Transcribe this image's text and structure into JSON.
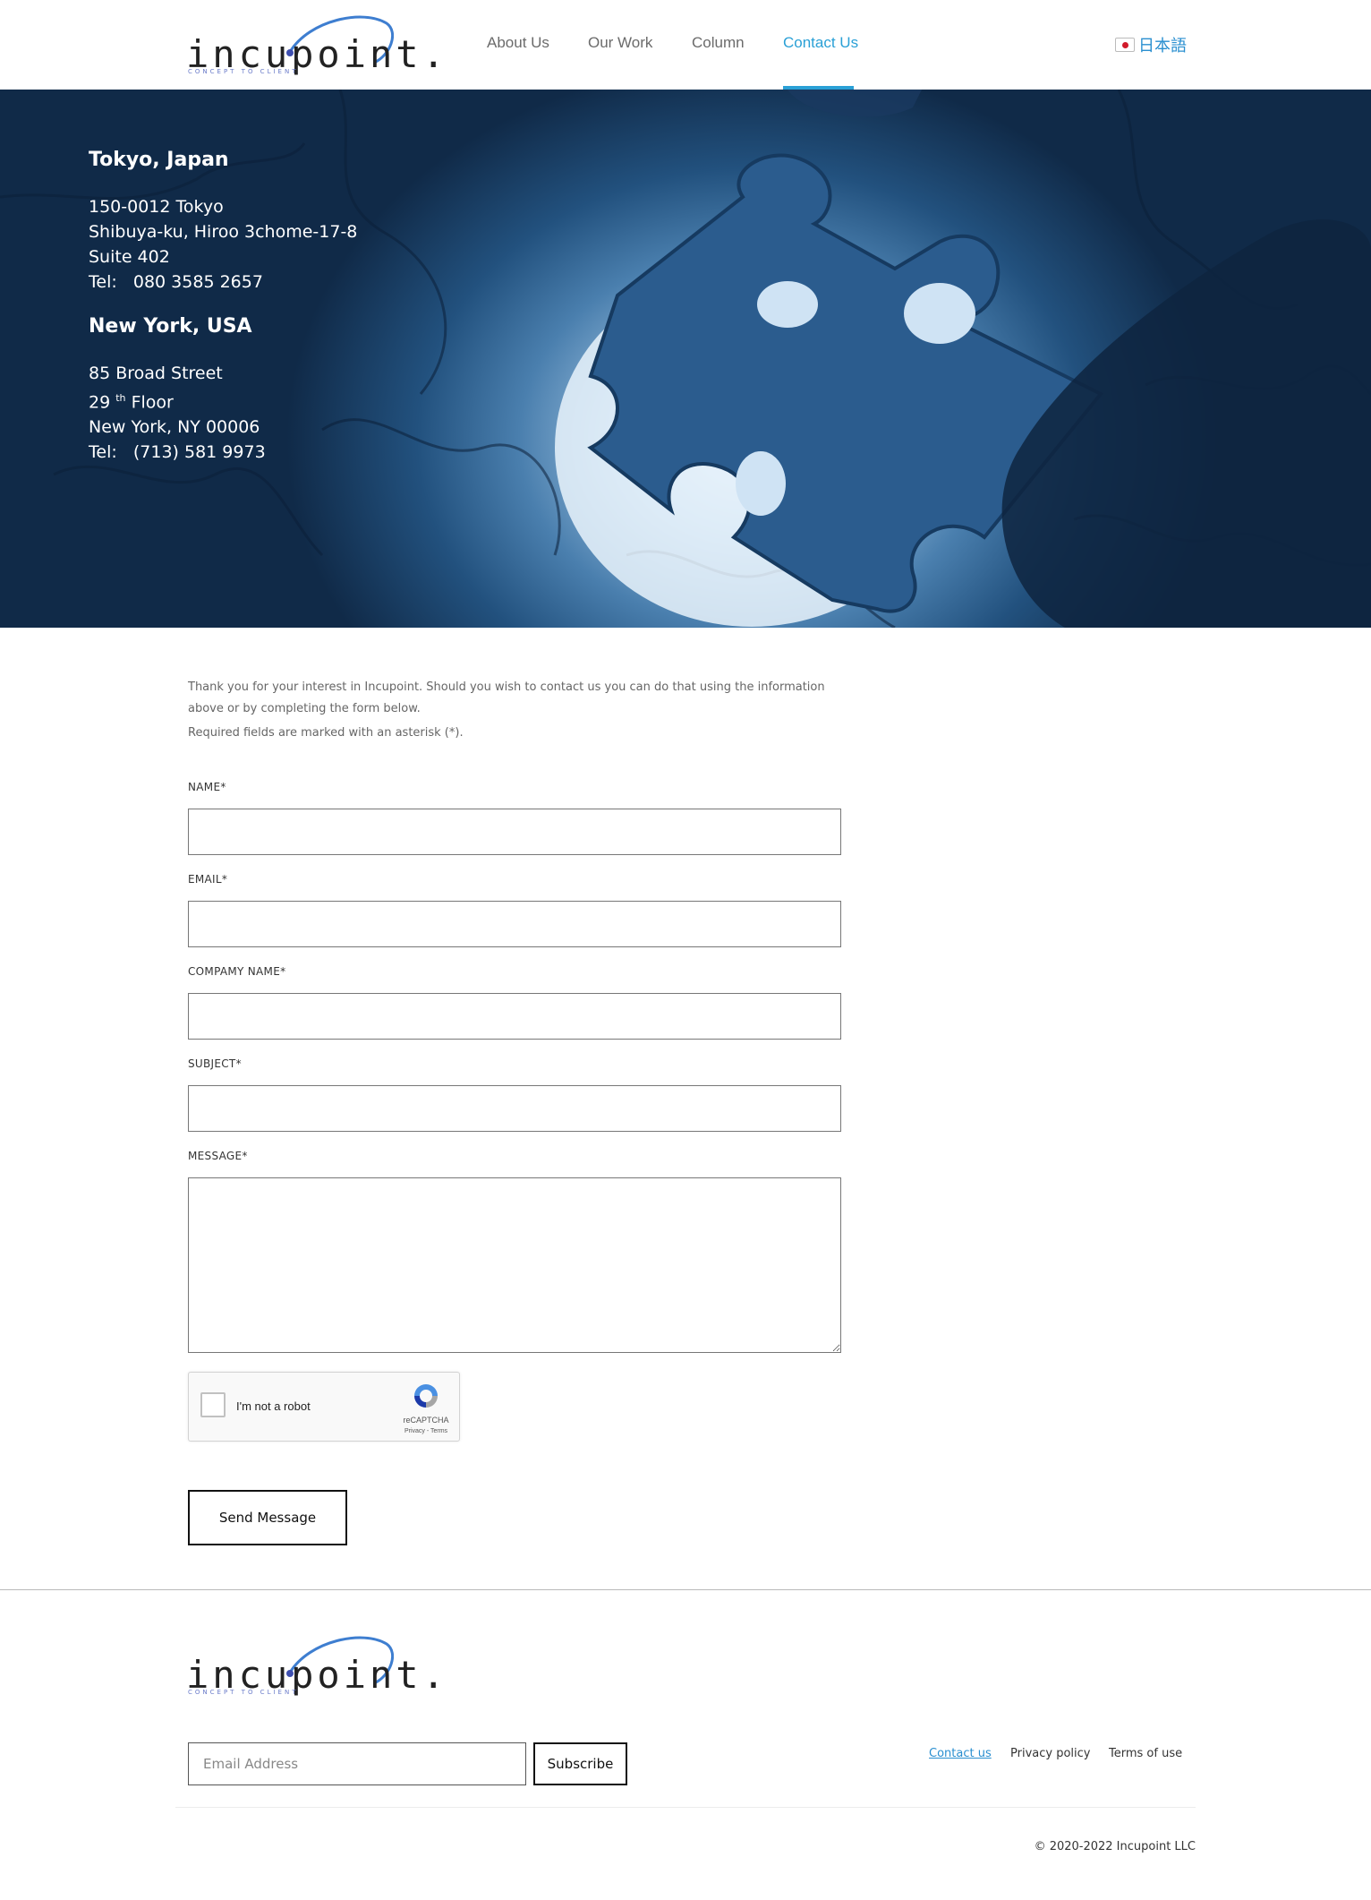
{
  "header": {
    "logo_text": "incupoint.",
    "logo_tagline": "CONCEPT TO CLIENT",
    "nav": [
      {
        "label": "About Us"
      },
      {
        "label": "Our Work"
      },
      {
        "label": "Column"
      },
      {
        "label": "Contact Us",
        "active": true
      }
    ],
    "language_label": "日本語",
    "accent_color": "#2aa0d6"
  },
  "offices": {
    "tokyo": {
      "title": "Tokyo, Japan",
      "line1": "150-0012 Tokyo",
      "line2": "Shibuya-ku, Hiroo 3chome-17-8",
      "line3": "Suite 402",
      "tel_label": "Tel:",
      "tel": "080 3585 2657"
    },
    "newyork": {
      "title": "New York, USA",
      "line1": "85 Broad Street",
      "floor_num": "29",
      "floor_sup": "th",
      "floor_word": "Floor",
      "line3": "New York, NY 00006",
      "tel_label": "Tel:",
      "tel": "(713) 581 9973"
    }
  },
  "intro": {
    "text": "Thank you for your interest in Incupoint. Should you wish to contact us you can do that using the information above or by completing the form below.",
    "required_note": "Required fields are marked with an asterisk (*)."
  },
  "form": {
    "name_label": "NAME*",
    "email_label": "EMAIL*",
    "company_label": "COMPAMY NAME*",
    "subject_label": "SUBJECT*",
    "message_label": "MESSAGE*",
    "captcha_label": "I'm not a robot",
    "captcha_brand": "reCAPTCHA",
    "captcha_terms": "Privacy - Terms",
    "send_label": "Send Message"
  },
  "footer": {
    "logo_text": "incupoint.",
    "logo_tagline": "CONCEPT TO CLIENT",
    "email_placeholder": "Email Address",
    "subscribe_label": "Subscribe",
    "links": [
      {
        "label": "Contact us"
      },
      {
        "label": "Privacy policy"
      },
      {
        "label": "Terms of use"
      }
    ],
    "copyright": "© 2020-2022 Incupoint LLC"
  }
}
